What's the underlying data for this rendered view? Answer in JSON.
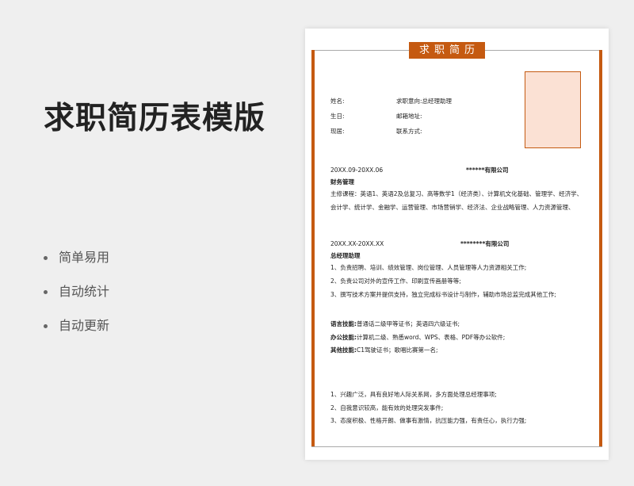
{
  "promo": {
    "title": "求职简历表模版",
    "features": [
      "简单易用",
      "自动统计",
      "自动更新"
    ]
  },
  "resume": {
    "header": "求职简历",
    "info": {
      "name_label": "姓名:",
      "intent_label": "求职意向:",
      "intent_value": "总经理助理",
      "birth_label": "生日:",
      "email_label": "邮箱地址:",
      "residence_label": "现居:",
      "contact_label": "联系方式:"
    },
    "education": {
      "period": "20XX.09-20XX.06",
      "school": "******有限公司",
      "major": "财务管理",
      "courses_line1": "主修课程：英语1、英语2及总复习、高等数学1（经济类）、计算机文化基础、管理学、经济学、",
      "courses_line2": "会计学、统计学、金融学、运营管理、市场营销学、经济法、企业战略管理、人力资源管理、"
    },
    "experience": {
      "period": "20XX.XX-20XX.XX",
      "company": "********有限公司",
      "position": "总经理助理",
      "duties": [
        "1、负责招聘、培训、绩效管理、岗位管理、人员管理等人力资源相关工作;",
        "2、负责公司对外的宣传工作、印刷宣传画册等等;",
        "3、撰写技术方案并提供支持，独立完成标书设计与制作，辅助市场总监完成其他工作;"
      ]
    },
    "skills": {
      "language_label": "语言技能:",
      "language_value": "普通话二级甲等证书；英语四六级证书;",
      "office_label": "办公技能:",
      "office_value": "计算机二级、熟悉word、WPS、表格、PDF等办公软件;",
      "other_label": "其他技能:",
      "other_value": "C1驾驶证书；歌唱比赛第一名;"
    },
    "self_evaluation": [
      "1、兴趣广泛，具有良好地人际关系网，多方面处理总经理事项;",
      "2、自我意识较高，能有效的处理突发事件;",
      "3、态度积极、性格开朗、做事有激情，抗压能力强，有责任心，执行力强;"
    ],
    "colors": {
      "accent": "#c55a11",
      "photo_fill": "#fbe1d4"
    }
  }
}
